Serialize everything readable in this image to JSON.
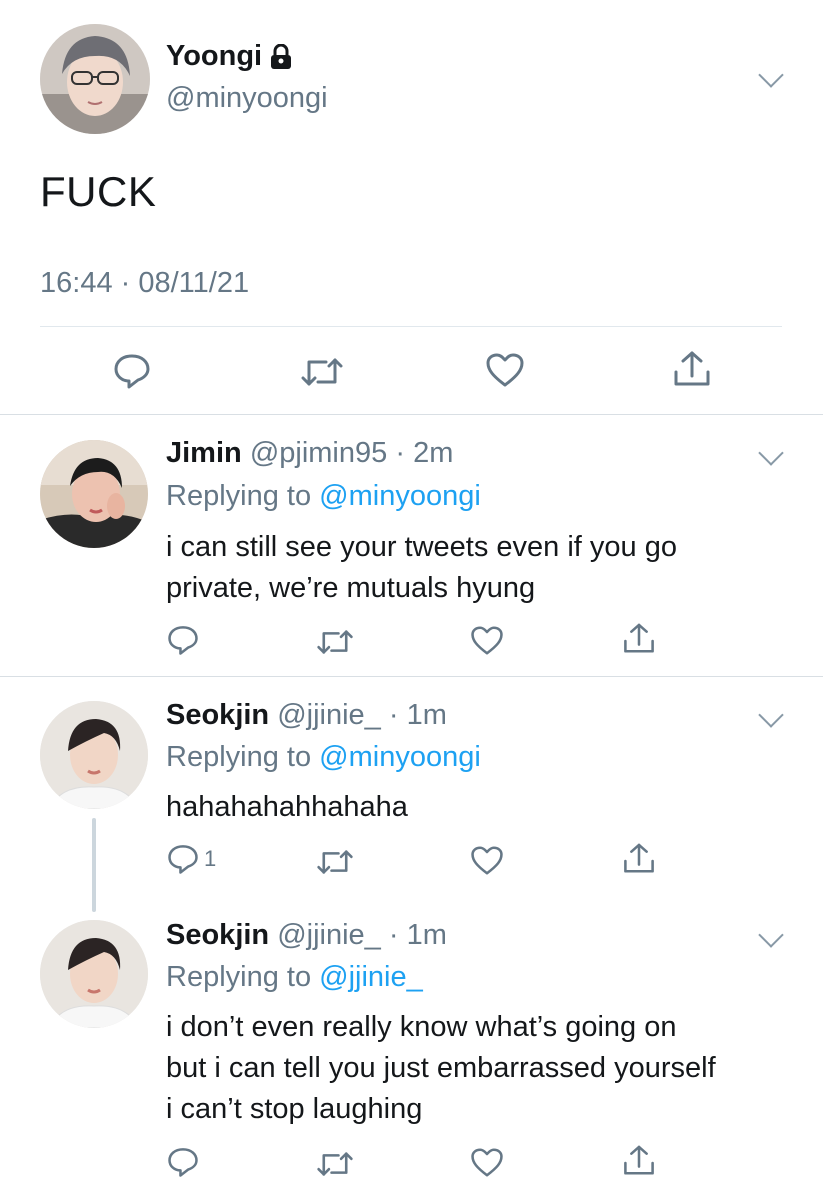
{
  "main_tweet": {
    "name": "Yoongi",
    "handle": "@minyoongi",
    "text": "FUCK",
    "timestamp": "16:44 · 08/11/21"
  },
  "replies": [
    {
      "name": "Jimin",
      "handle": "@pjimin95",
      "time": "2m",
      "replying_prefix": "Replying to ",
      "replying_to": "@minyoongi",
      "lines": [
        "i can still see your tweets even if you go",
        "private, we’re mutuals hyung"
      ],
      "reply_count": ""
    },
    {
      "name": "Seokjin",
      "handle": "@jjinie_",
      "time": "1m",
      "replying_prefix": "Replying to ",
      "replying_to": "@minyoongi",
      "lines": [
        "hahahahahhahaha"
      ],
      "reply_count": "1"
    },
    {
      "name": "Seokjin",
      "handle": "@jjinie_",
      "time": "1m",
      "replying_prefix": "Replying to ",
      "replying_to": "@jjinie_",
      "lines": [
        "i don’t even really know what’s going on",
        "but i can tell you just embarrassed yourself",
        "i can’t stop laughing"
      ],
      "reply_count": ""
    }
  ],
  "icons": {
    "lock": "lock-icon",
    "chevron": "chevron-down-icon",
    "reply": "reply-icon",
    "retweet": "retweet-icon",
    "like": "heart-icon",
    "share": "share-icon"
  },
  "colors": {
    "accent": "#1da1f2",
    "secondary_text": "#657786",
    "divider": "#e1e8ed"
  }
}
